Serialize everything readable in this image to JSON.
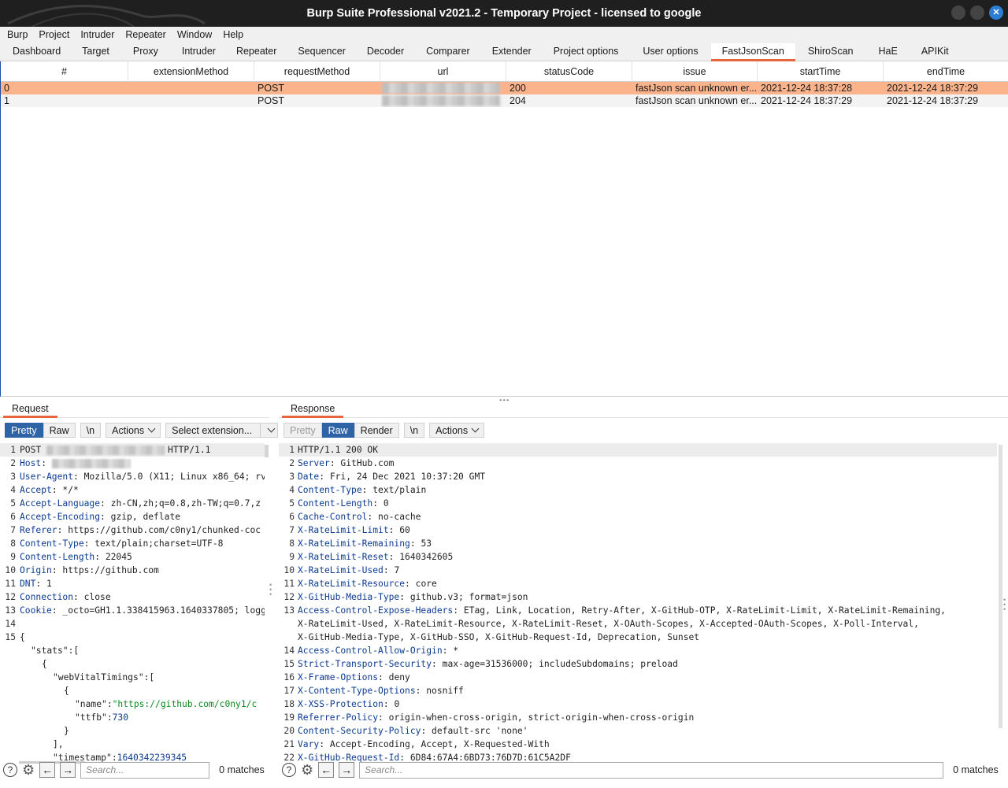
{
  "window": {
    "title": "Burp Suite Professional v2021.2 - Temporary Project - licensed to google"
  },
  "menu": [
    "Burp",
    "Project",
    "Intruder",
    "Repeater",
    "Window",
    "Help"
  ],
  "tabs": [
    {
      "label": "Dashboard"
    },
    {
      "label": "Target"
    },
    {
      "label": "Proxy"
    },
    {
      "label": "Intruder"
    },
    {
      "label": "Repeater"
    },
    {
      "label": "Sequencer"
    },
    {
      "label": "Decoder"
    },
    {
      "label": "Comparer"
    },
    {
      "label": "Extender"
    },
    {
      "label": "Project options"
    },
    {
      "label": "User options"
    },
    {
      "label": "FastJsonScan"
    },
    {
      "label": "ShiroScan"
    },
    {
      "label": "HaE"
    },
    {
      "label": "APIKit"
    }
  ],
  "active_tab": "FastJsonScan",
  "results_table": {
    "columns": [
      "#",
      "extensionMethod",
      "requestMethod",
      "url",
      "statusCode",
      "issue",
      "startTime",
      "endTime"
    ],
    "rows": [
      {
        "id": "0",
        "extensionMethod": "",
        "requestMethod": "POST",
        "statusCode": "200",
        "issue": "fastJson scan unknown er...",
        "startTime": "2021-12-24 18:37:28",
        "endTime": "2021-12-24 18:37:29"
      },
      {
        "id": "1",
        "extensionMethod": "",
        "requestMethod": "POST",
        "statusCode": "204",
        "issue": "fastJson scan unknown er...",
        "startTime": "2021-12-24 18:37:29",
        "endTime": "2021-12-24 18:37:29"
      }
    ]
  },
  "request": {
    "tab_label": "Request",
    "toolbar": {
      "pretty": "Pretty",
      "raw": "Raw",
      "newline": "\\n",
      "actions": "Actions",
      "extension": "Select extension..."
    },
    "lines": [
      {
        "n": "1",
        "k": "POST ",
        "v": "HTTP/1.1"
      },
      {
        "n": "2",
        "k": "Host",
        "v": ""
      },
      {
        "n": "3",
        "k": "User-Agent",
        "v": "Mozilla/5.0 (X11; Linux x86_64; rv:"
      },
      {
        "n": "4",
        "k": "Accept",
        "v": "*/*"
      },
      {
        "n": "5",
        "k": "Accept-Language",
        "v": "zh-CN,zh;q=0.8,zh-TW;q=0.7,z"
      },
      {
        "n": "6",
        "k": "Accept-Encoding",
        "v": "gzip, deflate"
      },
      {
        "n": "7",
        "k": "Referer",
        "v": "https://github.com/c0ny1/chunked-coc"
      },
      {
        "n": "8",
        "k": "Content-Type",
        "v": "text/plain;charset=UTF-8"
      },
      {
        "n": "9",
        "k": "Content-Length",
        "v": "22045"
      },
      {
        "n": "10",
        "k": "Origin",
        "v": "https://github.com"
      },
      {
        "n": "11",
        "k": "DNT",
        "v": "1"
      },
      {
        "n": "12",
        "k": "Connection",
        "v": "close"
      },
      {
        "n": "13",
        "k": "Cookie",
        "v": "_octo=GH1.1.338415963.1640337805; logg"
      },
      {
        "n": "14",
        "k": "",
        "v": ""
      },
      {
        "n": "15",
        "k": "",
        "v": "{"
      }
    ],
    "body": {
      "stats_key": "\"stats\"",
      "web_vital_key": "\"webVitalTimings\"",
      "name_key": "\"name\"",
      "name_val": "\"https://github.com/c0ny1/c",
      "ttfb_key": "\"ttfb\"",
      "ttfb_val": "730",
      "timestamp_key": "\"timestamp\"",
      "timestamp_val": "1640342239345"
    },
    "search_placeholder": "Search...",
    "matches": "0 matches"
  },
  "response": {
    "tab_label": "Response",
    "toolbar": {
      "pretty": "Pretty",
      "raw": "Raw",
      "render": "Render",
      "newline": "\\n",
      "actions": "Actions"
    },
    "lines": [
      {
        "n": "1",
        "k": "",
        "v": "HTTP/1.1 200 OK"
      },
      {
        "n": "2",
        "k": "Server",
        "v": "GitHub.com"
      },
      {
        "n": "3",
        "k": "Date",
        "v": "Fri, 24 Dec 2021 10:37:20 GMT"
      },
      {
        "n": "4",
        "k": "Content-Type",
        "v": "text/plain"
      },
      {
        "n": "5",
        "k": "Content-Length",
        "v": "0"
      },
      {
        "n": "6",
        "k": "Cache-Control",
        "v": "no-cache"
      },
      {
        "n": "7",
        "k": "X-RateLimit-Limit",
        "v": "60"
      },
      {
        "n": "8",
        "k": "X-RateLimit-Remaining",
        "v": "53"
      },
      {
        "n": "9",
        "k": "X-RateLimit-Reset",
        "v": "1640342605"
      },
      {
        "n": "10",
        "k": "X-RateLimit-Used",
        "v": "7"
      },
      {
        "n": "11",
        "k": "X-RateLimit-Resource",
        "v": "core"
      },
      {
        "n": "12",
        "k": "X-GitHub-Media-Type",
        "v": "github.v3; format=json"
      },
      {
        "n": "13",
        "k": "Access-Control-Expose-Headers",
        "v": "ETag, Link, Location, Retry-After, X-GitHub-OTP, X-RateLimit-Limit, X-RateLimit-Remaining,"
      },
      {
        "n": "",
        "k": "",
        "v": "X-RateLimit-Used, X-RateLimit-Resource, X-RateLimit-Reset, X-OAuth-Scopes, X-Accepted-OAuth-Scopes, X-Poll-Interval,"
      },
      {
        "n": "",
        "k": "",
        "v": "X-GitHub-Media-Type, X-GitHub-SSO, X-GitHub-Request-Id, Deprecation, Sunset"
      },
      {
        "n": "14",
        "k": "Access-Control-Allow-Origin",
        "v": "*"
      },
      {
        "n": "15",
        "k": "Strict-Transport-Security",
        "v": "max-age=31536000; includeSubdomains; preload"
      },
      {
        "n": "16",
        "k": "X-Frame-Options",
        "v": "deny"
      },
      {
        "n": "17",
        "k": "X-Content-Type-Options",
        "v": "nosniff"
      },
      {
        "n": "18",
        "k": "X-XSS-Protection",
        "v": "0"
      },
      {
        "n": "19",
        "k": "Referrer-Policy",
        "v": "origin-when-cross-origin, strict-origin-when-cross-origin"
      },
      {
        "n": "20",
        "k": "Content-Security-Policy",
        "v": "default-src 'none'"
      },
      {
        "n": "21",
        "k": "Vary",
        "v": "Accept-Encoding, Accept, X-Requested-With"
      },
      {
        "n": "22",
        "k": "X-GitHub-Request-Id",
        "v": "6D84:67A4:6BD73:76D7D:61C5A2DF"
      }
    ],
    "search_placeholder": "Search...",
    "matches": "0 matches"
  },
  "colors": {
    "accent": "#e8663d",
    "selected_row": "#fbb38b",
    "header_name": "#0b3b91",
    "string_value": "#0a8a1e",
    "active_button": "#2e64a6"
  }
}
